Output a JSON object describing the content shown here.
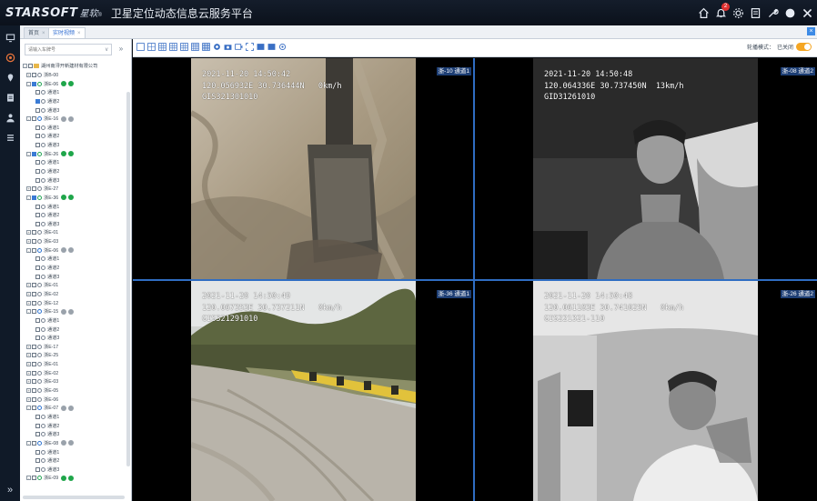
{
  "header": {
    "logo_text": "STARSOFT",
    "logo_cn": "星软",
    "logo_mark": "®",
    "title": "卫星定位动态信息云服务平台",
    "notification_count": "2",
    "icons": [
      "home-icon",
      "bell-icon",
      "gear-icon",
      "user-manage-icon",
      "wrench-icon",
      "theme-icon",
      "close-icon"
    ]
  },
  "rail": {
    "items": [
      "monitor-icon",
      "video-icon",
      "map-pin-icon",
      "report-icon",
      "user-icon",
      "list-icon"
    ],
    "expand_label": "»"
  },
  "tabs": [
    {
      "label": "首页",
      "close": "×"
    },
    {
      "label": "实时视频",
      "close": "×"
    }
  ],
  "tabs_close_all": "×",
  "tree": {
    "search_placeholder": "请输入车牌号",
    "search_chevron": "∨",
    "collapse_label": "»",
    "root": "湖州南浔开新建材有限公司",
    "nodes": [
      {
        "level": 1,
        "type": "vehicle",
        "label": "浙B-00",
        "status": "none",
        "expand": "+"
      },
      {
        "level": 1,
        "type": "vehicle",
        "label": "浙E-06",
        "status": "green",
        "expand": "-",
        "checked": true,
        "online": true
      },
      {
        "level": 2,
        "type": "channel",
        "label": "通道1"
      },
      {
        "level": 2,
        "type": "channel",
        "label": "通道2",
        "checked": true
      },
      {
        "level": 2,
        "type": "channel",
        "label": "通道3"
      },
      {
        "level": 1,
        "type": "vehicle",
        "label": "浙E-16",
        "status": "grey",
        "expand": "-",
        "blue": true
      },
      {
        "level": 2,
        "type": "channel",
        "label": "通道1"
      },
      {
        "level": 2,
        "type": "channel",
        "label": "通道2"
      },
      {
        "level": 2,
        "type": "channel",
        "label": "通道3"
      },
      {
        "level": 1,
        "type": "vehicle",
        "label": "浙E-26",
        "status": "green",
        "expand": "-",
        "checked": true,
        "online": true
      },
      {
        "level": 2,
        "type": "channel",
        "label": "通道1"
      },
      {
        "level": 2,
        "type": "channel",
        "label": "通道2"
      },
      {
        "level": 2,
        "type": "channel",
        "label": "通道3"
      },
      {
        "level": 1,
        "type": "vehicle",
        "label": "浙E-27",
        "status": "none",
        "expand": "+"
      },
      {
        "level": 1,
        "type": "vehicle",
        "label": "浙E-36",
        "status": "green",
        "expand": "-",
        "checked": true,
        "online": true
      },
      {
        "level": 2,
        "type": "channel",
        "label": "通道1"
      },
      {
        "level": 2,
        "type": "channel",
        "label": "通道2"
      },
      {
        "level": 2,
        "type": "channel",
        "label": "通道3"
      },
      {
        "level": 1,
        "type": "vehicle",
        "label": "浙E-01",
        "status": "none",
        "expand": "+"
      },
      {
        "level": 1,
        "type": "vehicle",
        "label": "浙E-03",
        "status": "none",
        "expand": "+"
      },
      {
        "level": 1,
        "type": "vehicle",
        "label": "浙E-06",
        "status": "grey",
        "expand": "-",
        "blue": true
      },
      {
        "level": 2,
        "type": "channel",
        "label": "通道1"
      },
      {
        "level": 2,
        "type": "channel",
        "label": "通道2"
      },
      {
        "level": 2,
        "type": "channel",
        "label": "通道3"
      },
      {
        "level": 1,
        "type": "vehicle",
        "label": "浙E-01",
        "status": "none",
        "expand": "+"
      },
      {
        "level": 1,
        "type": "vehicle",
        "label": "浙E-02",
        "status": "none",
        "expand": "+"
      },
      {
        "level": 1,
        "type": "vehicle",
        "label": "浙E-12",
        "status": "none",
        "expand": "+"
      },
      {
        "level": 1,
        "type": "vehicle",
        "label": "浙E-15",
        "status": "grey",
        "expand": "-",
        "blue": true
      },
      {
        "level": 2,
        "type": "channel",
        "label": "通道1"
      },
      {
        "level": 2,
        "type": "channel",
        "label": "通道2"
      },
      {
        "level": 2,
        "type": "channel",
        "label": "通道3"
      },
      {
        "level": 1,
        "type": "vehicle",
        "label": "浙E-17",
        "status": "none",
        "expand": "+"
      },
      {
        "level": 1,
        "type": "vehicle",
        "label": "浙E-25",
        "status": "none",
        "expand": "+"
      },
      {
        "level": 1,
        "type": "vehicle",
        "label": "浙E-01",
        "status": "none",
        "expand": "+"
      },
      {
        "level": 1,
        "type": "vehicle",
        "label": "浙E-02",
        "status": "none",
        "expand": "+"
      },
      {
        "level": 1,
        "type": "vehicle",
        "label": "浙E-03",
        "status": "none",
        "expand": "+"
      },
      {
        "level": 1,
        "type": "vehicle",
        "label": "浙E-05",
        "status": "none",
        "expand": "+"
      },
      {
        "level": 1,
        "type": "vehicle",
        "label": "浙E-06",
        "status": "none",
        "expand": "+"
      },
      {
        "level": 1,
        "type": "vehicle",
        "label": "浙E-07",
        "status": "grey",
        "expand": "-",
        "blue": true
      },
      {
        "level": 2,
        "type": "channel",
        "label": "通道1"
      },
      {
        "level": 2,
        "type": "channel",
        "label": "通道2"
      },
      {
        "level": 2,
        "type": "channel",
        "label": "通道3"
      },
      {
        "level": 1,
        "type": "vehicle",
        "label": "浙E-08",
        "status": "grey",
        "expand": "-",
        "blue": true
      },
      {
        "level": 2,
        "type": "channel",
        "label": "通道1"
      },
      {
        "level": 2,
        "type": "channel",
        "label": "通道2"
      },
      {
        "level": 2,
        "type": "channel",
        "label": "通道3"
      },
      {
        "level": 1,
        "type": "vehicle",
        "label": "浙E-09",
        "status": "green",
        "expand": "-",
        "online": true
      }
    ]
  },
  "toolbar": {
    "layout_buttons": [
      "layout-1-icon",
      "layout-4-icon",
      "layout-6-icon",
      "layout-8-icon",
      "layout-9-icon",
      "layout-16-icon",
      "layout-25-icon",
      "record-icon",
      "snapshot-icon",
      "talk-icon",
      "fullscreen-icon",
      "monitor-icon",
      "screen-icon",
      "settings-icon"
    ],
    "polling_label": "轮播模式：",
    "polling_state": "已关闭",
    "accent": "#f5a623"
  },
  "videos": [
    {
      "channel": "浙-10 通道1",
      "line1": "2021-11-20 14:50:42",
      "line2": "120.056932E 30.736444N   0km/h",
      "line3": "GIS321301010"
    },
    {
      "channel": "浙-08 通道2",
      "line1": "2021-11-20 14:50:48",
      "line2": "120.064336E 30.737450N  13km/h",
      "line3": "GID31261010"
    },
    {
      "channel": "浙-36 通道1",
      "line1": "2021-11-20 14:50:49",
      "line2": "120.067353E 30.737211N   0km/h",
      "line3": "GIS321291010"
    },
    {
      "channel": "浙-26 通道2",
      "line1": "2021-11-20 14:50:48",
      "line2": "120.061183E 30.741025N   0km/h",
      "line3": "GIS221321-110"
    }
  ]
}
